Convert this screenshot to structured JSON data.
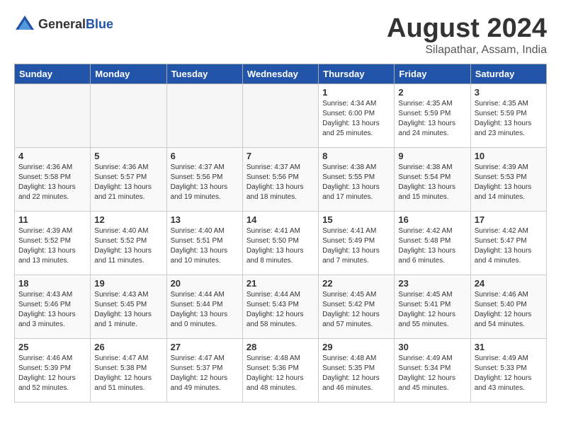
{
  "logo": {
    "general": "General",
    "blue": "Blue"
  },
  "title": "August 2024",
  "subtitle": "Silapathar, Assam, India",
  "days_of_week": [
    "Sunday",
    "Monday",
    "Tuesday",
    "Wednesday",
    "Thursday",
    "Friday",
    "Saturday"
  ],
  "weeks": [
    [
      {
        "day": "",
        "empty": true
      },
      {
        "day": "",
        "empty": true
      },
      {
        "day": "",
        "empty": true
      },
      {
        "day": "",
        "empty": true
      },
      {
        "day": "1",
        "sunrise": "4:34 AM",
        "sunset": "6:00 PM",
        "daylight": "13 hours and 25 minutes."
      },
      {
        "day": "2",
        "sunrise": "4:35 AM",
        "sunset": "5:59 PM",
        "daylight": "13 hours and 24 minutes."
      },
      {
        "day": "3",
        "sunrise": "4:35 AM",
        "sunset": "5:59 PM",
        "daylight": "13 hours and 23 minutes."
      }
    ],
    [
      {
        "day": "4",
        "sunrise": "4:36 AM",
        "sunset": "5:58 PM",
        "daylight": "13 hours and 22 minutes."
      },
      {
        "day": "5",
        "sunrise": "4:36 AM",
        "sunset": "5:57 PM",
        "daylight": "13 hours and 21 minutes."
      },
      {
        "day": "6",
        "sunrise": "4:37 AM",
        "sunset": "5:56 PM",
        "daylight": "13 hours and 19 minutes."
      },
      {
        "day": "7",
        "sunrise": "4:37 AM",
        "sunset": "5:56 PM",
        "daylight": "13 hours and 18 minutes."
      },
      {
        "day": "8",
        "sunrise": "4:38 AM",
        "sunset": "5:55 PM",
        "daylight": "13 hours and 17 minutes."
      },
      {
        "day": "9",
        "sunrise": "4:38 AM",
        "sunset": "5:54 PM",
        "daylight": "13 hours and 15 minutes."
      },
      {
        "day": "10",
        "sunrise": "4:39 AM",
        "sunset": "5:53 PM",
        "daylight": "13 hours and 14 minutes."
      }
    ],
    [
      {
        "day": "11",
        "sunrise": "4:39 AM",
        "sunset": "5:52 PM",
        "daylight": "13 hours and 13 minutes."
      },
      {
        "day": "12",
        "sunrise": "4:40 AM",
        "sunset": "5:52 PM",
        "daylight": "13 hours and 11 minutes."
      },
      {
        "day": "13",
        "sunrise": "4:40 AM",
        "sunset": "5:51 PM",
        "daylight": "13 hours and 10 minutes."
      },
      {
        "day": "14",
        "sunrise": "4:41 AM",
        "sunset": "5:50 PM",
        "daylight": "13 hours and 8 minutes."
      },
      {
        "day": "15",
        "sunrise": "4:41 AM",
        "sunset": "5:49 PM",
        "daylight": "13 hours and 7 minutes."
      },
      {
        "day": "16",
        "sunrise": "4:42 AM",
        "sunset": "5:48 PM",
        "daylight": "13 hours and 6 minutes."
      },
      {
        "day": "17",
        "sunrise": "4:42 AM",
        "sunset": "5:47 PM",
        "daylight": "13 hours and 4 minutes."
      }
    ],
    [
      {
        "day": "18",
        "sunrise": "4:43 AM",
        "sunset": "5:46 PM",
        "daylight": "13 hours and 3 minutes."
      },
      {
        "day": "19",
        "sunrise": "4:43 AM",
        "sunset": "5:45 PM",
        "daylight": "13 hours and 1 minute."
      },
      {
        "day": "20",
        "sunrise": "4:44 AM",
        "sunset": "5:44 PM",
        "daylight": "13 hours and 0 minutes."
      },
      {
        "day": "21",
        "sunrise": "4:44 AM",
        "sunset": "5:43 PM",
        "daylight": "12 hours and 58 minutes."
      },
      {
        "day": "22",
        "sunrise": "4:45 AM",
        "sunset": "5:42 PM",
        "daylight": "12 hours and 57 minutes."
      },
      {
        "day": "23",
        "sunrise": "4:45 AM",
        "sunset": "5:41 PM",
        "daylight": "12 hours and 55 minutes."
      },
      {
        "day": "24",
        "sunrise": "4:46 AM",
        "sunset": "5:40 PM",
        "daylight": "12 hours and 54 minutes."
      }
    ],
    [
      {
        "day": "25",
        "sunrise": "4:46 AM",
        "sunset": "5:39 PM",
        "daylight": "12 hours and 52 minutes."
      },
      {
        "day": "26",
        "sunrise": "4:47 AM",
        "sunset": "5:38 PM",
        "daylight": "12 hours and 51 minutes."
      },
      {
        "day": "27",
        "sunrise": "4:47 AM",
        "sunset": "5:37 PM",
        "daylight": "12 hours and 49 minutes."
      },
      {
        "day": "28",
        "sunrise": "4:48 AM",
        "sunset": "5:36 PM",
        "daylight": "12 hours and 48 minutes."
      },
      {
        "day": "29",
        "sunrise": "4:48 AM",
        "sunset": "5:35 PM",
        "daylight": "12 hours and 46 minutes."
      },
      {
        "day": "30",
        "sunrise": "4:49 AM",
        "sunset": "5:34 PM",
        "daylight": "12 hours and 45 minutes."
      },
      {
        "day": "31",
        "sunrise": "4:49 AM",
        "sunset": "5:33 PM",
        "daylight": "12 hours and 43 minutes."
      }
    ]
  ]
}
